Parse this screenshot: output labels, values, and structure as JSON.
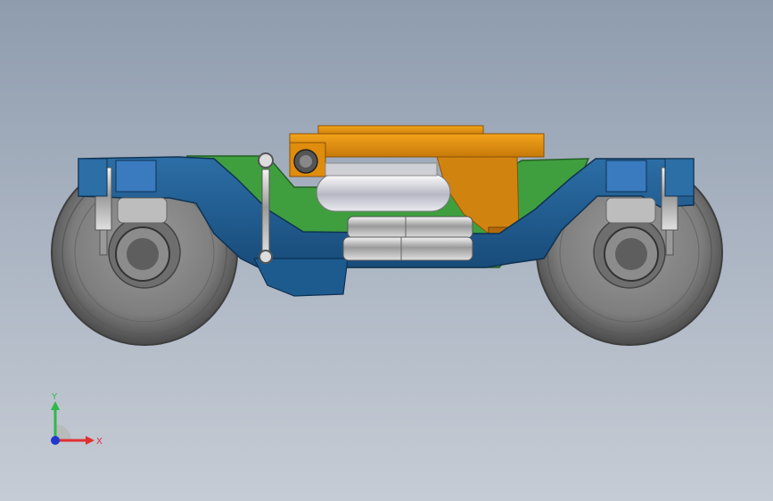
{
  "triad": {
    "y_label": "Y",
    "x_label": "X",
    "y_color": "#2fb84a",
    "x_color": "#e03030",
    "z_color": "#2038d0"
  },
  "model": {
    "colors": {
      "frame": "#1d5a8e",
      "frame_dark": "#153f66",
      "bolster": "#e6960f",
      "bolster_dark": "#b46a08",
      "subframe": "#3f9f3f",
      "wheel": "#7a7a7a",
      "wheel_dark": "#4a4a4a",
      "damper": "#d8d8d8",
      "airbag": "#e4e4ec"
    }
  }
}
